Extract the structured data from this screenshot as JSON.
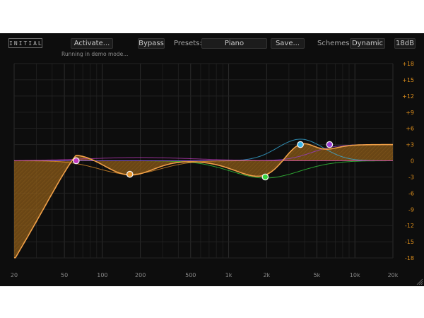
{
  "logo": "INITIAL",
  "toolbar": {
    "activate_label": "Activate...",
    "bypass_label": "Bypass",
    "presets_label": "Presets:",
    "preset_value": "Piano",
    "save_label": "Save...",
    "schemes_label": "Schemes:",
    "scheme_value": "Dynamic",
    "range_label": "18dB"
  },
  "status": "Running in demo mode...",
  "db_labels": [
    "+18",
    "+15",
    "+12",
    "+9",
    "+6",
    "+3",
    "0",
    "-3",
    "-6",
    "-9",
    "-12",
    "-15",
    "-18"
  ],
  "freq_labels": [
    "20",
    "50",
    "100",
    "200",
    "500",
    "1k",
    "2k",
    "5k",
    "10k",
    "20k"
  ],
  "colors": {
    "background": "#0d0d0d",
    "grid": "#262626",
    "db_label": "#e0901c",
    "freq_label": "#8a8a8a",
    "curve": "#f0a048",
    "fill": "#8a5a18",
    "node_purple": "#c039c0",
    "node_orange": "#e8962e",
    "node_green": "#37d43d",
    "node_cyan": "#3ab4e6",
    "node_violet": "#9a3cd6"
  },
  "bands": [
    {
      "name": "high-pass",
      "freq": 20,
      "gain": 0,
      "color": "#f0a048"
    },
    {
      "name": "low-shelf",
      "freq": 62,
      "gain": 0,
      "color": "#c039c0"
    },
    {
      "name": "low-mid-bell",
      "freq": 160,
      "gain": -2.5,
      "color": "#e8962e"
    },
    {
      "name": "mid-bell",
      "freq": 1950,
      "gain": -3,
      "color": "#37d43d"
    },
    {
      "name": "presence-bell",
      "freq": 3700,
      "gain": 3,
      "color": "#3ab4e6"
    },
    {
      "name": "high-shelf",
      "freq": 6300,
      "gain": 3,
      "color": "#9a3cd6"
    }
  ]
}
